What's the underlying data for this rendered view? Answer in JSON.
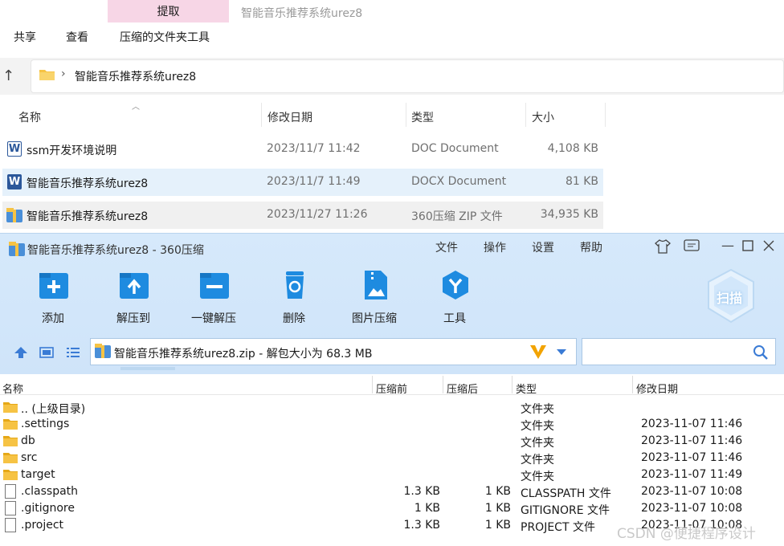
{
  "explorer": {
    "extract_tab": "提取",
    "window_title": "智能音乐推荐系统urez8",
    "ribbon": [
      "共享",
      "查看",
      "压缩的文件夹工具"
    ],
    "address": "智能音乐推荐系统urez8",
    "columns": [
      "名称",
      "修改日期",
      "类型",
      "大小"
    ],
    "files": [
      {
        "name": "ssm开发环境说明",
        "date": "2023/11/7 11:42",
        "type": "DOC Document",
        "size": "4,108 KB"
      },
      {
        "name": "智能音乐推荐系统urez8",
        "date": "2023/11/7 11:49",
        "type": "DOCX Document",
        "size": "81 KB"
      },
      {
        "name": "智能音乐推荐系统urez8",
        "date": "2023/11/27 11:26",
        "type": "360压缩 ZIP 文件",
        "size": "34,935 KB"
      }
    ]
  },
  "zip": {
    "title": "智能音乐推荐系统urez8 - 360压缩",
    "menu": [
      "文件",
      "操作",
      "设置",
      "帮助"
    ],
    "tools": [
      "添加",
      "解压到",
      "一键解压",
      "删除",
      "图片压缩",
      "工具"
    ],
    "scan_label": "扫描",
    "address": "智能音乐推荐系统urez8.zip - 解包大小为 68.3 MB",
    "columns": [
      "名称",
      "压缩前",
      "压缩后",
      "类型",
      "修改日期"
    ],
    "rows": [
      {
        "name": ".. (上级目录)",
        "before": "",
        "after": "",
        "type": "文件夹",
        "date": ""
      },
      {
        "name": ".settings",
        "before": "",
        "after": "",
        "type": "文件夹",
        "date": "2023-11-07 11:46"
      },
      {
        "name": "db",
        "before": "",
        "after": "",
        "type": "文件夹",
        "date": "2023-11-07 11:46"
      },
      {
        "name": "src",
        "before": "",
        "after": "",
        "type": "文件夹",
        "date": "2023-11-07 11:46"
      },
      {
        "name": "target",
        "before": "",
        "after": "",
        "type": "文件夹",
        "date": "2023-11-07 11:49"
      },
      {
        "name": ".classpath",
        "before": "1.3 KB",
        "after": "1 KB",
        "type": "CLASSPATH 文件",
        "date": "2023-11-07 10:08"
      },
      {
        "name": ".gitignore",
        "before": "1 KB",
        "after": "1 KB",
        "type": "GITIGNORE 文件",
        "date": "2023-11-07 10:08"
      },
      {
        "name": ".project",
        "before": "1.3 KB",
        "after": "1 KB",
        "type": "PROJECT 文件",
        "date": "2023-11-07 10:08"
      }
    ]
  },
  "watermark": "CSDN @便捷程序设计",
  "colors": {
    "accent": "#1e8be0",
    "folder": "#f6c344",
    "selection": "#e5f1fb"
  }
}
